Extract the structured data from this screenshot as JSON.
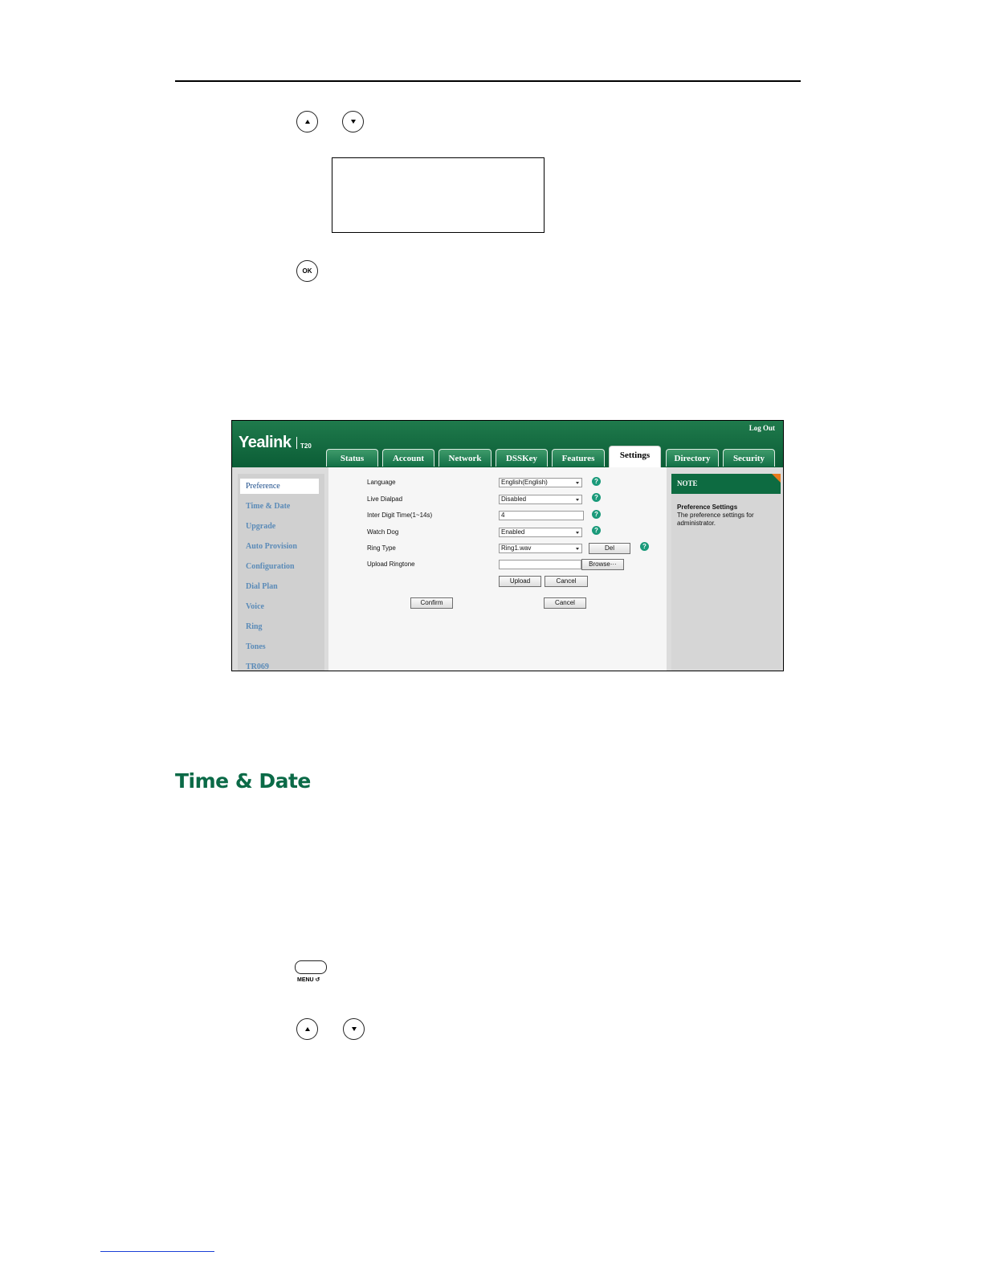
{
  "keys": {
    "ok_label": "OK",
    "menu_label": "MENU ↺"
  },
  "screenshot": {
    "logo": "Yealink",
    "model": "T20",
    "logout": "Log Out",
    "tabs": [
      {
        "label": "Status"
      },
      {
        "label": "Account"
      },
      {
        "label": "Network"
      },
      {
        "label": "DSSKey"
      },
      {
        "label": "Features"
      },
      {
        "label": "Settings"
      },
      {
        "label": "Directory"
      },
      {
        "label": "Security"
      }
    ],
    "sidebar": [
      {
        "label": "Preference"
      },
      {
        "label": "Time & Date"
      },
      {
        "label": "Upgrade"
      },
      {
        "label": "Auto Provision"
      },
      {
        "label": "Configuration"
      },
      {
        "label": "Dial Plan"
      },
      {
        "label": "Voice"
      },
      {
        "label": "Ring"
      },
      {
        "label": "Tones"
      },
      {
        "label": "TR069"
      }
    ],
    "form": {
      "language_label": "Language",
      "language_value": "English(English)",
      "live_dialpad_label": "Live Dialpad",
      "live_dialpad_value": "Disabled",
      "inter_digit_label": "Inter Digit Time(1~14s)",
      "inter_digit_value": "4",
      "watch_dog_label": "Watch Dog",
      "watch_dog_value": "Enabled",
      "ring_type_label": "Ring Type",
      "ring_type_value": "Ring1.wav",
      "del_label": "Del",
      "upload_ringtone_label": "Upload Ringtone",
      "browse_label": "Browse···",
      "upload_label": "Upload",
      "cancel_upload_label": "Cancel",
      "confirm_label": "Confirm",
      "cancel_label": "Cancel",
      "help_glyph": "?"
    },
    "note": {
      "header": "NOTE",
      "title": "Preference Settings",
      "text": "The preference settings for administrator."
    }
  },
  "section": {
    "title": "Time & Date"
  },
  "icons": [
    "up-arrow-key-icon",
    "down-arrow-key-icon",
    "ok-key-icon",
    "menu-key-icon",
    "help-icon"
  ]
}
